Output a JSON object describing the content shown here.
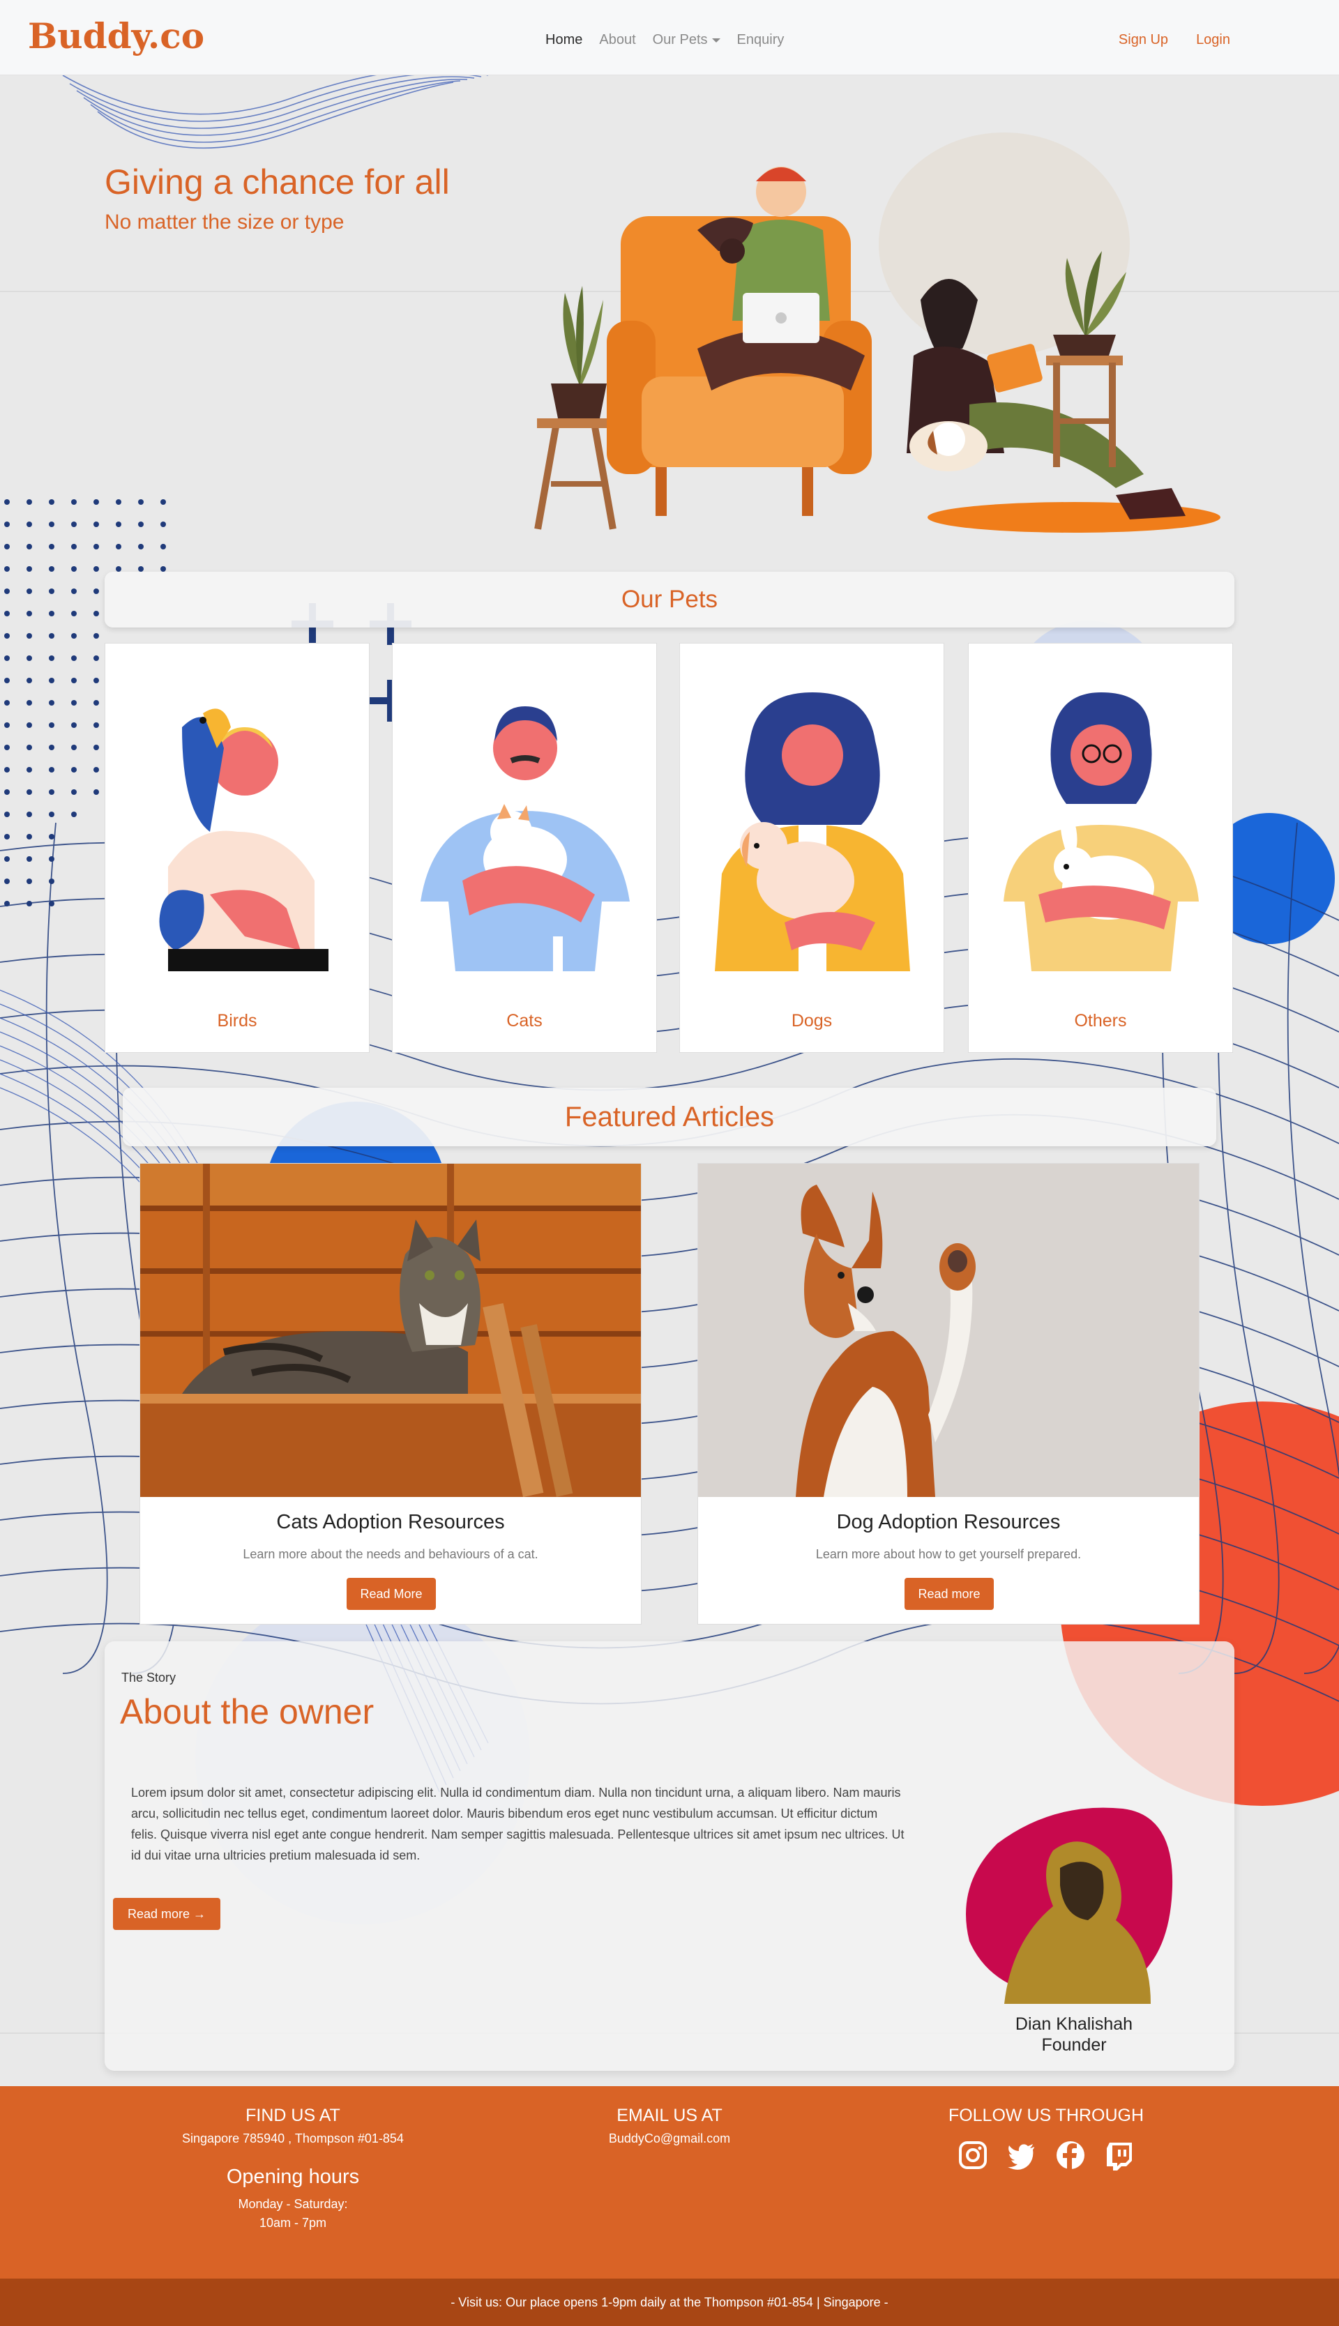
{
  "navbar": {
    "brand": "Buddy.co",
    "links": [
      {
        "label": "Home"
      },
      {
        "label": "About"
      },
      {
        "label": "Our Pets"
      },
      {
        "label": "Enquiry"
      }
    ],
    "signup": "Sign Up",
    "login": "Login"
  },
  "hero": {
    "title": "Giving a chance for all",
    "subtitle": "No matter the size or type"
  },
  "pets": {
    "heading": "Our Pets",
    "cards": [
      {
        "label": "Birds",
        "icon": "person-with-parrot-illustration"
      },
      {
        "label": "Cats",
        "icon": "person-holding-cat-illustration"
      },
      {
        "label": "Dogs",
        "icon": "person-holding-dog-illustration"
      },
      {
        "label": "Others",
        "icon": "person-holding-rabbit-illustration"
      }
    ]
  },
  "featured": {
    "heading": "Featured Articles",
    "articles": [
      {
        "title": "Cats Adoption Resources",
        "text": "Learn more about the needs and behaviours of a cat.",
        "button": "Read More",
        "image": "tabby-cat-in-wooden-box"
      },
      {
        "title": "Dog Adoption Resources",
        "text": "Learn more about how to get yourself prepared.",
        "button": "Read more",
        "image": "basenji-dog-raising-paw"
      }
    ]
  },
  "about": {
    "kicker": "The Story",
    "title": "About the owner",
    "paragraph": "Lorem ipsum dolor sit amet, consectetur adipiscing elit. Nulla id condimentum diam. Nulla non tincidunt urna, a aliquam libero. Nam mauris arcu, sollicitudin nec tellus eget, condimentum laoreet dolor. Mauris bibendum eros eget nunc vestibulum accumsan. Ut efficitur dictum felis. Quisque viverra nisl eget ante congue hendrerit. Nam semper sagittis malesuada. Pellentesque ultrices sit amet ipsum nec ultrices. Ut id dui vitae urna ultricies pretium malesuada id sem.",
    "button": "Read more →",
    "owner_name": "Dian Khalishah",
    "owner_role": "Founder"
  },
  "footer": {
    "find_heading": "FIND US AT",
    "address": "Singapore 785940 , Thompson #01-854",
    "hours_heading": "Opening hours",
    "hours_days": "Monday - Saturday:",
    "hours_time": "10am - 7pm",
    "email_heading": "EMAIL US AT",
    "email": "BuddyCo@gmail.com",
    "follow_heading": "FOLLOW US THROUGH",
    "social": [
      "instagram-icon",
      "twitter-icon",
      "facebook-icon",
      "twitch-icon"
    ],
    "bottom_text": "- Visit us: Our place opens 1-9pm daily at the Thompson #01-854 | Singapore -"
  },
  "colors": {
    "accent": "#d96326",
    "footer_bottom": "#a84614",
    "navy_lines": "#1f3a7a",
    "blue_circle": "#1a66d9",
    "red_circle": "#f05033"
  }
}
